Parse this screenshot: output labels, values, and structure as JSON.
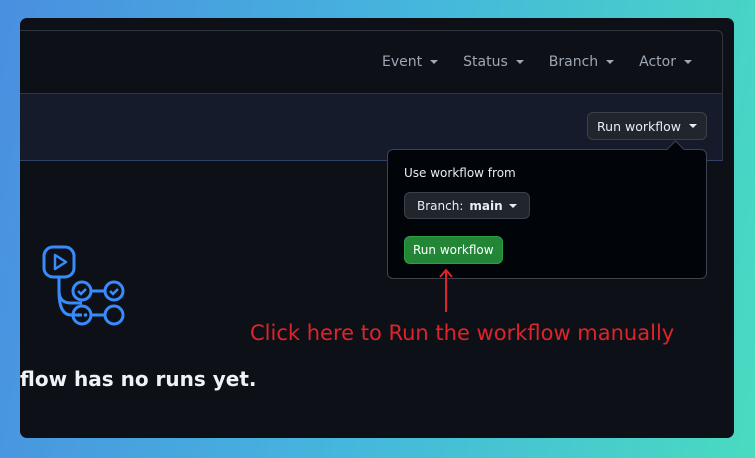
{
  "filters": [
    {
      "label": "Event"
    },
    {
      "label": "Status"
    },
    {
      "label": "Branch"
    },
    {
      "label": "Actor"
    }
  ],
  "run_workflow_button": {
    "label": "Run workflow"
  },
  "popover": {
    "heading": "Use workflow from",
    "branch_prefix": "Branch:",
    "branch_value": "main",
    "submit_label": "Run workflow"
  },
  "annotation": {
    "text": "Click here to Run the workflow manually",
    "color": "#e0232a"
  },
  "empty_state": {
    "title": "flow has no runs yet."
  },
  "colors": {
    "accent_blue": "#388bfd",
    "green": "#238636"
  }
}
